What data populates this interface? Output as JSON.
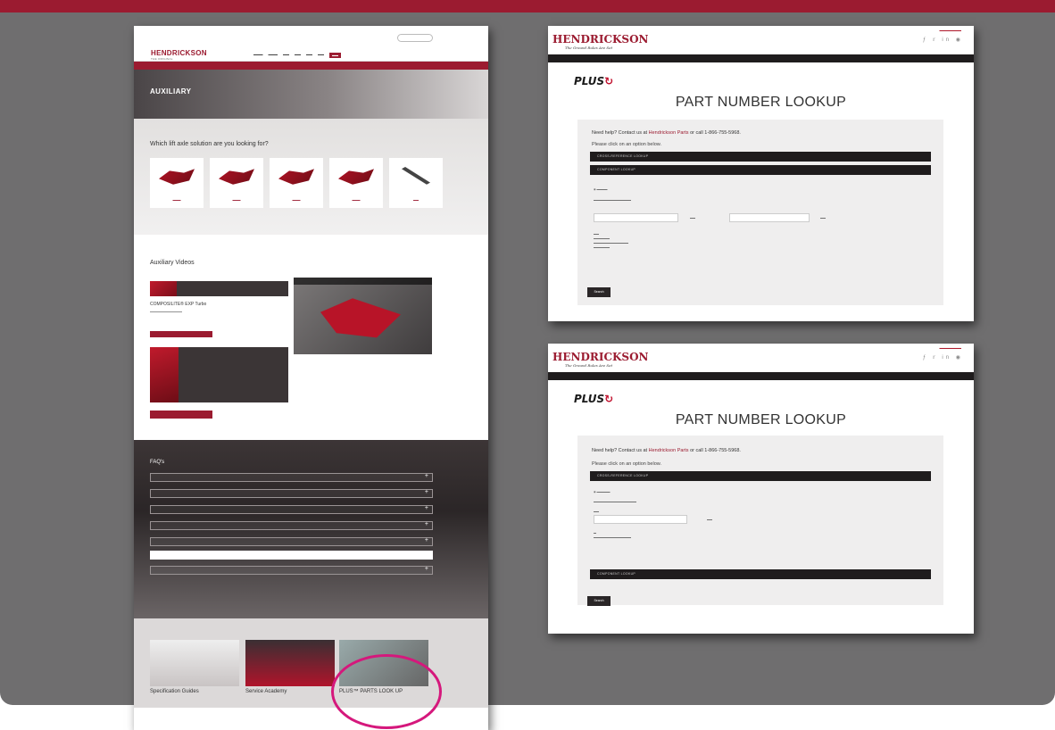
{
  "colors": {
    "brand_red": "#9b1b30",
    "stage_gray": "#6f6e6f",
    "dark_bar": "#1f1c1d",
    "highlight_circle": "#d5187c"
  },
  "left_page": {
    "logo": "HENDRICKSON",
    "logo_tagline": "THE ORIGINAL",
    "hero_title": "AUXILIARY",
    "solutions_heading": "Which lift axle solution are you looking for?",
    "videos_heading": "Auxiliary Videos",
    "featured_video_title": "COMPOSILITE® EXP Turbo",
    "faq_heading": "FAQ's",
    "tiles": [
      "Specification Guides",
      "Service Academy",
      "PLUS™ PARTS LOOK UP"
    ]
  },
  "right_page_1": {
    "logo": "HENDRICKSON",
    "logo_tagline": "The Ground Rules Are Set",
    "plus_logo": "PLUS",
    "title": "PART NUMBER LOOKUP",
    "help_prefix": "Need help? Contact us at",
    "help_link": "Hendrickson Parts",
    "help_suffix": "or call 1-866-755-5968.",
    "prompt": "Please click on an option below.",
    "bar1": "CROSS-REFERENCE LOOKUP",
    "bar2": "COMPONENT LOOKUP",
    "search_btn": "Search"
  },
  "right_page_2": {
    "logo": "HENDRICKSON",
    "logo_tagline": "The Ground Rules Are Set",
    "plus_logo": "PLUS",
    "title": "PART NUMBER LOOKUP",
    "help_prefix": "Need help? Contact us at",
    "help_link": "Hendrickson Parts",
    "help_suffix": "or call 1-866-755-5968.",
    "prompt": "Please click on an option below.",
    "bar1": "CROSS-REFERENCE LOOKUP",
    "bar2": "COMPONENT LOOKUP",
    "search_btn": "Search"
  }
}
